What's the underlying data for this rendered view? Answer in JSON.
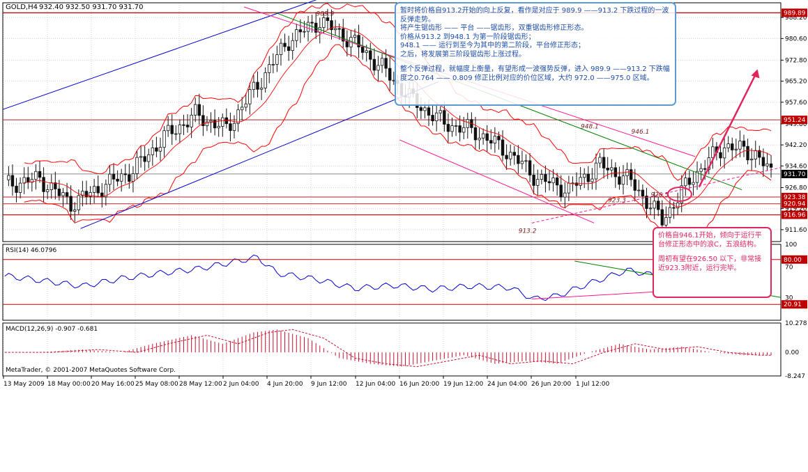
{
  "header": {
    "symbol": "GOLD,H4",
    "ohlc": "932.40 932.50 931.70 931.70"
  },
  "colors": {
    "price": "#111111",
    "bollinger": "#ff0000",
    "resistance_line": "#b22222",
    "channel_up": "#0000cc",
    "channel_down": "#ff1493",
    "trend_green": "#008000",
    "rsi_line": "#0000cc",
    "macd_hist": "#c8102e",
    "macd_signal": "#c8102e",
    "annotation_red": "#e0245e",
    "annotation_blue": "#1e4ea8"
  },
  "chart_data": [
    {
      "type": "candlestick",
      "title": "GOLD,H4",
      "ylim": [
        907.3,
        993.5
      ],
      "y_ticks": [
        "988.20",
        "980.60",
        "972.80",
        "965.20",
        "957.60",
        "949.80",
        "942.20",
        "934.60",
        "926.80",
        "919.20",
        "911.60"
      ],
      "x_tick_labels": [
        "13 May 2009",
        "18 May 00:00",
        "20 May 16:00",
        "25 May 08:00",
        "28 May 12:00",
        "2 Jun 04:00",
        "4 Jun 20:00",
        "9 Jun 12:00",
        "12 Jun 04:00",
        "16 Jun 20:00",
        "19 Jun 12:00",
        "24 Jun 04:00",
        "26 Jun 20:00",
        "1 Jul 12:00"
      ],
      "series": [
        {
          "x": [
            1,
            9,
            17,
            25,
            33,
            41,
            49,
            57,
            65,
            73,
            81,
            89,
            97,
            105,
            113,
            121,
            129,
            137,
            145,
            153,
            161,
            169,
            177,
            185,
            193,
            197
          ],
          "values": [
            928,
            930,
            921,
            927,
            933,
            945,
            953,
            948,
            964,
            980,
            987,
            980,
            970,
            958,
            950,
            947,
            940,
            930,
            926,
            935,
            929,
            915,
            931,
            942,
            939,
            931.7
          ]
        }
      ],
      "level_labels": [
        "989.89",
        "951.24",
        "931.70",
        "923.38",
        "920.94",
        "916.96"
      ],
      "level_values": [
        989.89,
        951.24,
        931.7,
        923.38,
        920.94,
        916.96
      ],
      "annotations": [
        "989.9",
        "948.1",
        "946.1",
        "926.5",
        "923.3",
        "913.2"
      ]
    },
    {
      "type": "line",
      "title": "RSI(14) 46.0796",
      "ylim": [
        0,
        100
      ],
      "y_ticks": [
        "100",
        "70",
        "30"
      ],
      "level_labels": [
        "80.00",
        "20.91"
      ],
      "series": [
        {
          "x": [
            1,
            10,
            20,
            30,
            40,
            50,
            60,
            65,
            70,
            80,
            90,
            100,
            110,
            120,
            130,
            136,
            142,
            150,
            160,
            168,
            176,
            182,
            190,
            197
          ],
          "values": [
            58,
            52,
            45,
            55,
            62,
            68,
            78,
            83,
            62,
            54,
            42,
            46,
            41,
            45,
            43,
            28,
            32,
            48,
            66,
            58,
            45,
            58,
            43,
            46
          ]
        }
      ]
    },
    {
      "type": "bar",
      "title": "MACD(12,26,9) -0.907 -0.681",
      "ylim": [
        -8.247,
        10.278
      ],
      "y_ticks": [
        "10.278",
        "0.00",
        "-8.247"
      ],
      "series": [
        {
          "x": [
            8,
            20,
            30,
            38,
            48,
            56,
            64,
            70,
            78,
            86,
            94,
            102,
            110,
            118,
            126,
            134,
            142,
            150,
            158,
            166,
            174,
            182,
            190,
            197
          ],
          "values": [
            0,
            1,
            0,
            3,
            6,
            3,
            7,
            8,
            5,
            -2,
            -4,
            -5,
            -3,
            -1,
            -4,
            -3,
            -4,
            0,
            3,
            1,
            2,
            0,
            -1,
            -1
          ]
        }
      ]
    }
  ],
  "notes": {
    "blue": [
      "暂时将价格自913.2开始的向上反复，看作是对应于 989.9 ——913.2 下跌过程的一波反弹走势。",
      "将产生锯齿形 —— 平台 ——锯齿形，双重锯齿形修正形态。",
      "价格从913.2 到948.1 为第一阶段锯齿形；",
      "948.1 —— 运行到至今为其中的第二阶段，平台修正形态；",
      "之后，将发展第三阶段锯齿形上涨过程。",
      "整个反弹过程，就幅度上衡量，有望形成一波强势反弹，进入 989.9 ——913.2 下跌幅度之0.764 —— 0.809 修正比例对应的价位区域，大约 972.0 ——975.0 区域。"
    ],
    "red": [
      "价格自946.1开始，倾向于运行平台修正形态中的浪C，五浪结构。",
      "周初有望在926.50 以下，非常接近923.3附近，运行完毕。"
    ]
  },
  "footer": {
    "copyright": "MetaTrader, © 2001-2007 MetaQuotes Software Corp."
  }
}
